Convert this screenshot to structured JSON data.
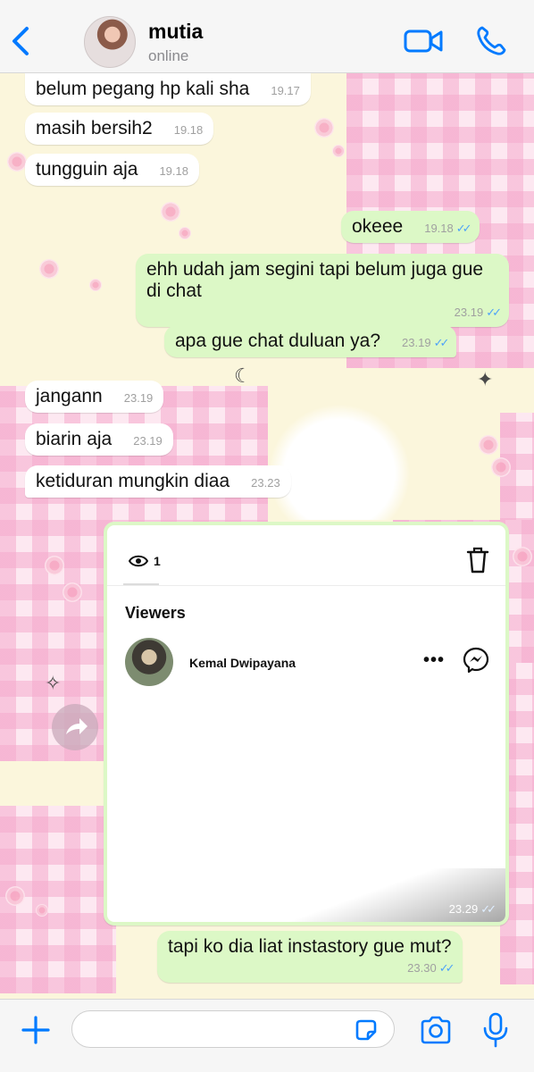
{
  "header": {
    "contact_name": "mutia",
    "status": "online"
  },
  "messages": [
    {
      "direction": "in",
      "text": "belum pegang hp kali sha",
      "time": "19.17"
    },
    {
      "direction": "in",
      "text": "masih bersih2",
      "time": "19.18"
    },
    {
      "direction": "in",
      "text": "tungguin aja",
      "time": "19.18"
    },
    {
      "direction": "out",
      "text": "okeee",
      "time": "19.18",
      "read": true
    },
    {
      "direction": "out",
      "text": "ehh udah jam segini tapi belum juga gue di chat",
      "time": "23.19",
      "read": true
    },
    {
      "direction": "out",
      "text": "apa gue chat duluan ya?",
      "time": "23.19",
      "read": true
    },
    {
      "direction": "in",
      "text": "jangann",
      "time": "23.19"
    },
    {
      "direction": "in",
      "text": "biarin aja",
      "time": "23.19"
    },
    {
      "direction": "in",
      "text": "ketiduran mungkin diaa",
      "time": "23.23"
    },
    {
      "direction": "out",
      "text": "tapi ko dia liat instastory gue mut?",
      "time": "23.30",
      "read": true
    }
  ],
  "screenshot_message": {
    "time": "23.29",
    "read": true,
    "view_count": "1",
    "viewers_heading": "Viewers",
    "viewer_name": "Kemal Dwipayana",
    "more_label": "•••"
  },
  "composer": {
    "placeholder": ""
  },
  "icons": {
    "back": "chevron-left-icon",
    "video": "video-call-icon",
    "phone": "phone-call-icon",
    "plus": "plus-icon",
    "sticker": "sticker-icon",
    "camera": "camera-icon",
    "mic": "microphone-icon",
    "forward": "forward-icon",
    "eye": "eye-icon",
    "trash": "trash-icon",
    "messenger": "messenger-icon"
  },
  "colors": {
    "accent": "#007aff",
    "outgoing_bubble": "#dcf8c6",
    "incoming_bubble": "#ffffff",
    "read_ticks": "#4fa3f7"
  }
}
